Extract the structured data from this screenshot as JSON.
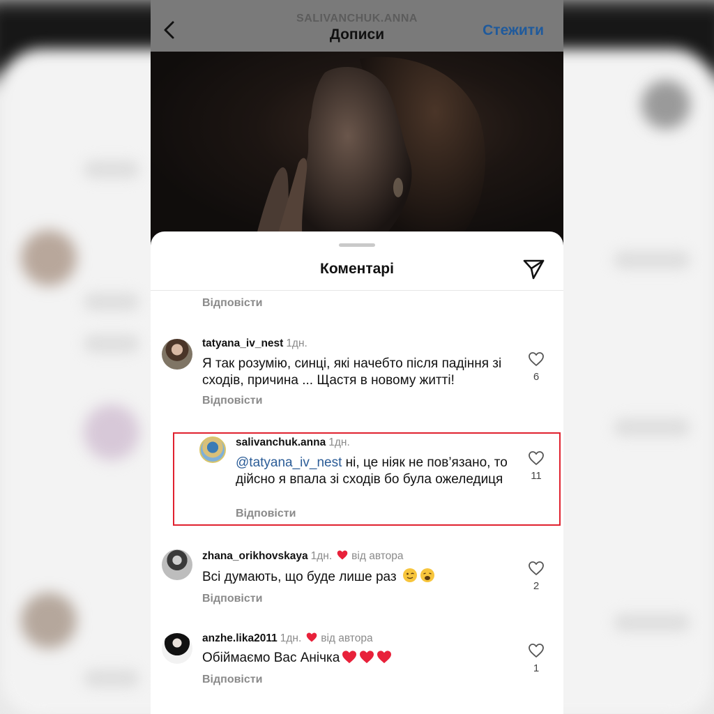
{
  "header": {
    "username": "SALIVANCHUK.ANNA",
    "title": "Дописи",
    "follow_label": "Стежити"
  },
  "sheet": {
    "title": "Коментарі",
    "top_reply_label": "Відповісти"
  },
  "comments": [
    {
      "user": "tatyana_iv_nest",
      "time": "1дн.",
      "text": "Я так розумію, синці, які начебто після падіння зі сходів, причина ... Щастя в новому житті!",
      "likes": "6",
      "reply_label": "Відповісти"
    },
    {
      "user": "salivanchuk.anna",
      "time": "1дн.",
      "mention": "@tatyana_iv_nest",
      "text": " ні, це ніяк не пов’язано, то дійсно я впала зі сходів бо була ожеледиця",
      "likes": "11",
      "reply_label": "Відповісти",
      "highlighted": true
    },
    {
      "user": "zhana_orikhovskaya",
      "time": "1дн.",
      "author_badge": "від автора",
      "text": "Всі думають, що буде лише раз",
      "emojis": [
        "wink-face",
        "weary-face"
      ],
      "likes": "2",
      "reply_label": "Відповісти"
    },
    {
      "user": "anzhe.lika2011",
      "time": "1дн.",
      "author_badge": "від автора",
      "text": "Обіймаємо Вас Анічка",
      "emojis": [
        "red-heart",
        "red-heart",
        "red-heart"
      ],
      "likes": "1",
      "reply_label": "Відповісти"
    }
  ],
  "colors": {
    "mention": "#2b5c97",
    "highlight_border": "#e0212f",
    "heart_red": "#e8213a",
    "follow_blue": "#1f5a9c"
  }
}
